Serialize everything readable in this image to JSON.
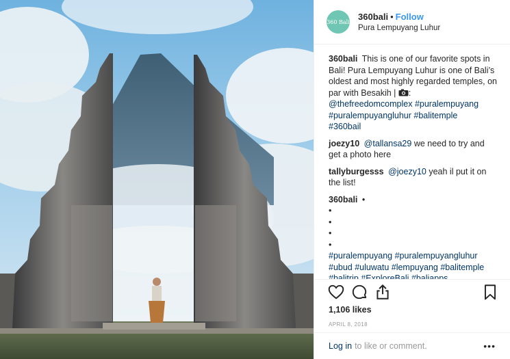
{
  "header": {
    "avatar_text": "360 Bali",
    "username": "360bali",
    "separator": "•",
    "follow_label": "Follow",
    "location": "Pura Lempuyang Luhur"
  },
  "caption": {
    "username": "360bali",
    "text": "This is one of our favorite spots in Bali! Pura Lempuyang Luhur is one of Bali’s oldest and most highly regarded temples, on par with Besakih |",
    "camera_icon": "camera-icon",
    "colon": ":",
    "mention": "@thefreedomcomplex",
    "tags": [
      "#puralempuyang",
      "#puralempuyangluhur",
      "#balitemple",
      "#360bail"
    ]
  },
  "comments": [
    {
      "username": "joezy10",
      "mention": "@tallansa29",
      "text": "we need to try and get a photo here"
    },
    {
      "username": "tallyburgesss",
      "mention": "@joezy10",
      "text": "yeah il put it on the list!"
    }
  ],
  "second_post": {
    "username": "360bali",
    "bullet": "•",
    "bullets": [
      "•",
      "•",
      "•",
      "•"
    ],
    "tags_line1": "#puralempuyang #puralempuyangluhur",
    "tags_line2": "#ubud #uluwatu #lempuyang #balitemple",
    "tags_line3": "#balitrip #ExploreBali #baliapps"
  },
  "actions": {
    "like_icon": "heart-icon",
    "comment_icon": "comment-icon",
    "share_icon": "share-icon",
    "save_icon": "bookmark-icon"
  },
  "likes": "1,106 likes",
  "date": "APRIL 8, 2018",
  "footer": {
    "login_label": "Log in",
    "prompt": "to like or comment.",
    "more": "•••"
  },
  "colors": {
    "link": "#003569",
    "follow": "#3897f0",
    "avatar": "#6fc6b2",
    "sky": "#8ec3e6"
  }
}
